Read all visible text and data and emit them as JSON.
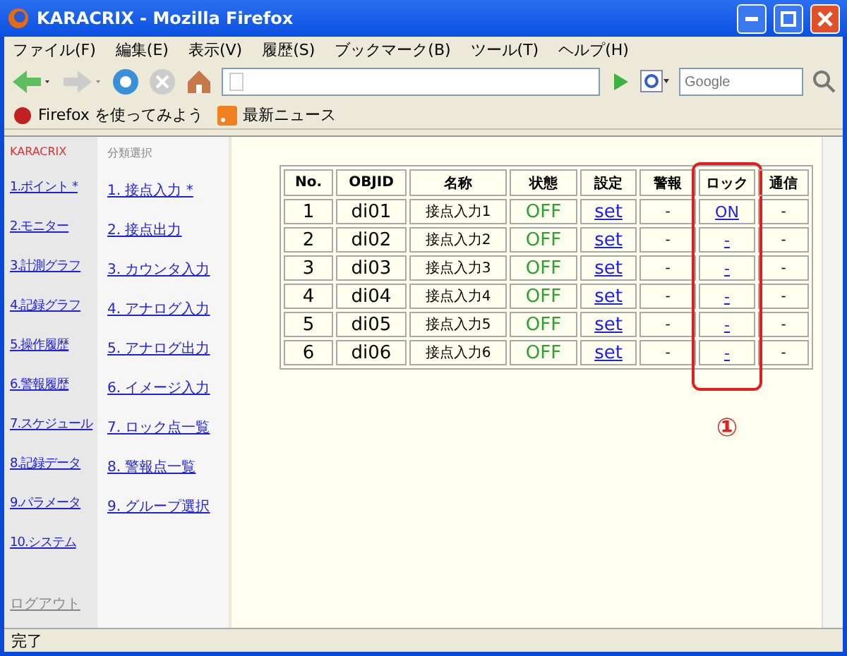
{
  "window": {
    "title": "KARACRIX - Mozilla Firefox"
  },
  "menu": [
    "ファイル(F)",
    "編集(E)",
    "表示(V)",
    "履歴(S)",
    "ブックマーク(B)",
    "ツール(T)",
    "ヘルプ(H)"
  ],
  "search": {
    "placeholder": "Google"
  },
  "bookmarks": [
    {
      "label": "Firefox を使ってみよう",
      "kind": "firefox"
    },
    {
      "label": "最新ニュース",
      "kind": "rss"
    }
  ],
  "brand": "KARACRIX",
  "nav": [
    "1.ポイント *",
    "2.モニター",
    "3.計測グラフ",
    "4.記録グラフ",
    "5.操作履歴",
    "6.警報履歴",
    "7.スケジュール",
    "8.記録データ",
    "9.パラメータ",
    "10.システム"
  ],
  "logout": "ログアウト",
  "subnav": {
    "heading": "分類選択",
    "items": [
      "1. 接点入力 *",
      "2. 接点出力",
      "3. カウンタ入力",
      "4. アナログ入力",
      "5. アナログ出力",
      "6. イメージ入力",
      "7. ロック点一覧",
      "8. 警報点一覧",
      "9. グループ選択"
    ]
  },
  "table": {
    "columns": [
      {
        "label": "No.",
        "highlighted": false
      },
      {
        "label": "OBJID",
        "highlighted": false
      },
      {
        "label": "名称",
        "highlighted": false
      },
      {
        "label": "状態",
        "highlighted": false
      },
      {
        "label": "設定",
        "highlighted": false
      },
      {
        "label": "警報",
        "highlighted": false
      },
      {
        "label": "ロック",
        "highlighted": true
      },
      {
        "label": "通信",
        "highlighted": false
      }
    ],
    "rows": [
      {
        "no": "1",
        "objid": "di01",
        "name": "接点入力1",
        "state": "OFF",
        "setting": "set",
        "alarm": "-",
        "lock": "ON",
        "comm": "-"
      },
      {
        "no": "2",
        "objid": "di02",
        "name": "接点入力2",
        "state": "OFF",
        "setting": "set",
        "alarm": "-",
        "lock": "-",
        "comm": "-"
      },
      {
        "no": "3",
        "objid": "di03",
        "name": "接点入力3",
        "state": "OFF",
        "setting": "set",
        "alarm": "-",
        "lock": "-",
        "comm": "-"
      },
      {
        "no": "4",
        "objid": "di04",
        "name": "接点入力4",
        "state": "OFF",
        "setting": "set",
        "alarm": "-",
        "lock": "-",
        "comm": "-"
      },
      {
        "no": "5",
        "objid": "di05",
        "name": "接点入力5",
        "state": "OFF",
        "setting": "set",
        "alarm": "-",
        "lock": "-",
        "comm": "-"
      },
      {
        "no": "6",
        "objid": "di06",
        "name": "接点入力6",
        "state": "OFF",
        "setting": "set",
        "alarm": "-",
        "lock": "-",
        "comm": "-"
      }
    ]
  },
  "annotation": {
    "label": "①"
  },
  "status_bar": "完了"
}
